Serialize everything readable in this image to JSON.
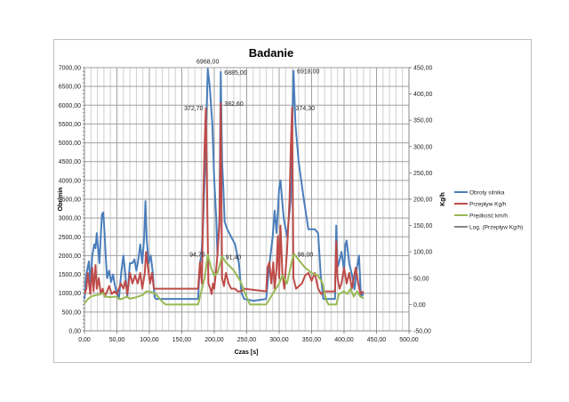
{
  "chart_data": {
    "type": "line",
    "title": "Badanie",
    "xlabel": "Czas [s]",
    "ylabel": "Obr/min",
    "y2label": "Kg/h",
    "xlim": [
      0,
      500
    ],
    "ylim": [
      0,
      7000
    ],
    "y2lim": [
      -50,
      450
    ],
    "grid": true,
    "legend": "right",
    "x_ticks": [
      "0,00",
      "50,00",
      "100,00",
      "150,00",
      "200,00",
      "250,00",
      "300,00",
      "350,00",
      "400,00",
      "450,00",
      "500,00"
    ],
    "y_ticks": [
      "0,00",
      "500,00",
      "1000,00",
      "1500,00",
      "2000,00",
      "2500,00",
      "3000,00",
      "3500,00",
      "4000,00",
      "4500,00",
      "5000,00",
      "5500,00",
      "6000,00",
      "6500,00",
      "7000,00"
    ],
    "y2_ticks": [
      "-50,00",
      "0,00",
      "50,00",
      "100,00",
      "150,00",
      "200,00",
      "250,00",
      "300,00",
      "350,00",
      "400,00",
      "450,00"
    ],
    "series": [
      {
        "name": "Obroty silnika",
        "axis": "left",
        "color": "#4a7ebb",
        "points": [
          [
            0,
            850
          ],
          [
            3,
            1500
          ],
          [
            5,
            1700
          ],
          [
            7,
            1850
          ],
          [
            9,
            1200
          ],
          [
            12,
            2000
          ],
          [
            15,
            2300
          ],
          [
            17,
            2200
          ],
          [
            19,
            2600
          ],
          [
            21,
            2200
          ],
          [
            23,
            1800
          ],
          [
            25,
            2500
          ],
          [
            27,
            3100
          ],
          [
            29,
            3150
          ],
          [
            31,
            2600
          ],
          [
            33,
            1900
          ],
          [
            35,
            1400
          ],
          [
            38,
            1600
          ],
          [
            41,
            1300
          ],
          [
            44,
            1500
          ],
          [
            47,
            1200
          ],
          [
            50,
            1000
          ],
          [
            53,
            850
          ],
          [
            57,
            1600
          ],
          [
            60,
            2000
          ],
          [
            63,
            1500
          ],
          [
            66,
            900
          ],
          [
            70,
            1800
          ],
          [
            74,
            1800
          ],
          [
            77,
            1900
          ],
          [
            80,
            1600
          ],
          [
            83,
            1900
          ],
          [
            86,
            2300
          ],
          [
            89,
            1800
          ],
          [
            92,
            2500
          ],
          [
            94,
            3450
          ],
          [
            96,
            2400
          ],
          [
            99,
            1800
          ],
          [
            102,
            2000
          ],
          [
            105,
            1600
          ],
          [
            108,
            900
          ],
          [
            110,
            850
          ],
          [
            150,
            850
          ],
          [
            175,
            850
          ],
          [
            178,
            1800
          ],
          [
            180,
            2000
          ],
          [
            182,
            2500
          ],
          [
            186,
            4500
          ],
          [
            190,
            6968
          ],
          [
            193,
            6500
          ],
          [
            197,
            5500
          ],
          [
            200,
            4000
          ],
          [
            203,
            3000
          ],
          [
            205,
            2000
          ],
          [
            208,
            3000
          ],
          [
            210,
            6885
          ],
          [
            212,
            4500
          ],
          [
            214,
            3800
          ],
          [
            216,
            2900
          ],
          [
            220,
            2700
          ],
          [
            226,
            2500
          ],
          [
            232,
            2300
          ],
          [
            238,
            1800
          ],
          [
            242,
            1000
          ],
          [
            246,
            850
          ],
          [
            260,
            800
          ],
          [
            280,
            850
          ],
          [
            284,
            1600
          ],
          [
            290,
            2500
          ],
          [
            293,
            3200
          ],
          [
            296,
            2600
          ],
          [
            300,
            3800
          ],
          [
            302,
            4000
          ],
          [
            304,
            3600
          ],
          [
            307,
            3000
          ],
          [
            312,
            2500
          ],
          [
            318,
            3500
          ],
          [
            322,
            6918
          ],
          [
            325,
            5500
          ],
          [
            330,
            4500
          ],
          [
            338,
            3500
          ],
          [
            345,
            2700
          ],
          [
            355,
            2700
          ],
          [
            360,
            2600
          ],
          [
            364,
            1500
          ],
          [
            368,
            850
          ],
          [
            386,
            850
          ],
          [
            388,
            2800
          ],
          [
            390,
            1700
          ],
          [
            392,
            1800
          ],
          [
            396,
            2100
          ],
          [
            400,
            1600
          ],
          [
            402,
            2300
          ],
          [
            404,
            2400
          ],
          [
            408,
            1800
          ],
          [
            412,
            1500
          ],
          [
            416,
            1100
          ],
          [
            420,
            1700
          ],
          [
            423,
            2000
          ],
          [
            426,
            900
          ],
          [
            430,
            1000
          ]
        ]
      },
      {
        "name": "Przepływ Kg/h",
        "axis": "right",
        "color": "#be4b48",
        "points": [
          [
            0,
            20
          ],
          [
            3,
            30
          ],
          [
            5,
            60
          ],
          [
            7,
            40
          ],
          [
            9,
            20
          ],
          [
            12,
            70
          ],
          [
            14,
            25
          ],
          [
            17,
            75
          ],
          [
            19,
            30
          ],
          [
            22,
            50
          ],
          [
            25,
            20
          ],
          [
            28,
            30
          ],
          [
            31,
            15
          ],
          [
            35,
            25
          ],
          [
            38,
            35
          ],
          [
            42,
            20
          ],
          [
            46,
            25
          ],
          [
            50,
            20
          ],
          [
            56,
            40
          ],
          [
            60,
            30
          ],
          [
            63,
            45
          ],
          [
            66,
            20
          ],
          [
            70,
            60
          ],
          [
            74,
            40
          ],
          [
            78,
            55
          ],
          [
            82,
            40
          ],
          [
            86,
            60
          ],
          [
            89,
            30
          ],
          [
            93,
            60
          ],
          [
            95,
            100
          ],
          [
            98,
            70
          ],
          [
            101,
            40
          ],
          [
            104,
            60
          ],
          [
            107,
            30
          ],
          [
            110,
            30
          ],
          [
            175,
            30
          ],
          [
            178,
            80
          ],
          [
            181,
            40
          ],
          [
            183,
            200
          ],
          [
            185,
            300
          ],
          [
            187,
            372.7
          ],
          [
            189,
            200
          ],
          [
            191,
            40
          ],
          [
            194,
            30
          ],
          [
            196,
            20
          ],
          [
            198,
            40
          ],
          [
            200,
            30
          ],
          [
            204,
            80
          ],
          [
            208,
            150
          ],
          [
            210,
            382.6
          ],
          [
            212,
            50
          ],
          [
            215,
            35
          ],
          [
            218,
            60
          ],
          [
            222,
            40
          ],
          [
            226,
            30
          ],
          [
            232,
            30
          ],
          [
            236,
            25
          ],
          [
            242,
            25
          ],
          [
            246,
            30
          ],
          [
            280,
            25
          ],
          [
            282,
            70
          ],
          [
            285,
            80
          ],
          [
            288,
            40
          ],
          [
            291,
            80
          ],
          [
            293,
            30
          ],
          [
            296,
            70
          ],
          [
            298,
            130
          ],
          [
            300,
            50
          ],
          [
            302,
            150
          ],
          [
            305,
            60
          ],
          [
            308,
            30
          ],
          [
            312,
            100
          ],
          [
            316,
            200
          ],
          [
            318,
            300
          ],
          [
            320,
            374.3
          ],
          [
            322,
            50
          ],
          [
            326,
            30
          ],
          [
            335,
            40
          ],
          [
            340,
            55
          ],
          [
            345,
            60
          ],
          [
            350,
            45
          ],
          [
            355,
            60
          ],
          [
            360,
            30
          ],
          [
            365,
            20
          ],
          [
            370,
            25
          ],
          [
            386,
            25
          ],
          [
            388,
            120
          ],
          [
            390,
            50
          ],
          [
            393,
            30
          ],
          [
            396,
            40
          ],
          [
            400,
            70
          ],
          [
            404,
            40
          ],
          [
            408,
            60
          ],
          [
            412,
            30
          ],
          [
            418,
            70
          ],
          [
            422,
            40
          ],
          [
            425,
            20
          ],
          [
            430,
            25
          ]
        ]
      },
      {
        "name": "Prędkość km/h",
        "axis": "right",
        "color": "#98b954",
        "points": [
          [
            0,
            2
          ],
          [
            5,
            10
          ],
          [
            10,
            15
          ],
          [
            15,
            17
          ],
          [
            20,
            18
          ],
          [
            25,
            20
          ],
          [
            28,
            22
          ],
          [
            32,
            15
          ],
          [
            40,
            14
          ],
          [
            48,
            15
          ],
          [
            55,
            10
          ],
          [
            60,
            12
          ],
          [
            65,
            15
          ],
          [
            70,
            11
          ],
          [
            80,
            14
          ],
          [
            90,
            18
          ],
          [
            95,
            25
          ],
          [
            100,
            25
          ],
          [
            110,
            20
          ],
          [
            120,
            5
          ],
          [
            125,
            0
          ],
          [
            175,
            0
          ],
          [
            185,
            50
          ],
          [
            190,
            94.7
          ],
          [
            195,
            70
          ],
          [
            200,
            55
          ],
          [
            205,
            60
          ],
          [
            212,
            91.4
          ],
          [
            218,
            80
          ],
          [
            230,
            65
          ],
          [
            240,
            45
          ],
          [
            248,
            20
          ],
          [
            255,
            0
          ],
          [
            280,
            0
          ],
          [
            290,
            20
          ],
          [
            300,
            40
          ],
          [
            305,
            55
          ],
          [
            312,
            40
          ],
          [
            320,
            85
          ],
          [
            323,
            96
          ],
          [
            330,
            85
          ],
          [
            340,
            70
          ],
          [
            350,
            60
          ],
          [
            360,
            55
          ],
          [
            367,
            40
          ],
          [
            372,
            10
          ],
          [
            376,
            0
          ],
          [
            388,
            0
          ],
          [
            392,
            20
          ],
          [
            400,
            25
          ],
          [
            405,
            20
          ],
          [
            410,
            30
          ],
          [
            415,
            15
          ],
          [
            420,
            25
          ],
          [
            425,
            15
          ],
          [
            430,
            12
          ]
        ]
      },
      {
        "name": "Log. (Przepływ Kg/h)",
        "axis": "right",
        "color": "#333333",
        "points": []
      }
    ],
    "annotations": [
      {
        "text": "6968,00",
        "series": 0,
        "x": 190,
        "y": 6968,
        "pos": "above"
      },
      {
        "text": "6885,00",
        "series": 0,
        "x": 210,
        "y": 6885,
        "pos": "right"
      },
      {
        "text": "6918,00",
        "series": 0,
        "x": 322,
        "y": 6918,
        "pos": "right"
      },
      {
        "text": "372,70",
        "series": 1,
        "x": 187,
        "y": 372.7,
        "pos": "left"
      },
      {
        "text": "382,60",
        "series": 1,
        "x": 210,
        "y": 382.6,
        "pos": "right"
      },
      {
        "text": "374,30",
        "series": 1,
        "x": 320,
        "y": 374.3,
        "pos": "right"
      },
      {
        "text": "94,70",
        "series": 2,
        "x": 190,
        "y": 94.7,
        "pos": "left"
      },
      {
        "text": "91,40",
        "series": 2,
        "x": 212,
        "y": 91.4,
        "pos": "right"
      },
      {
        "text": "96,00",
        "series": 2,
        "x": 323,
        "y": 96,
        "pos": "right"
      }
    ]
  }
}
